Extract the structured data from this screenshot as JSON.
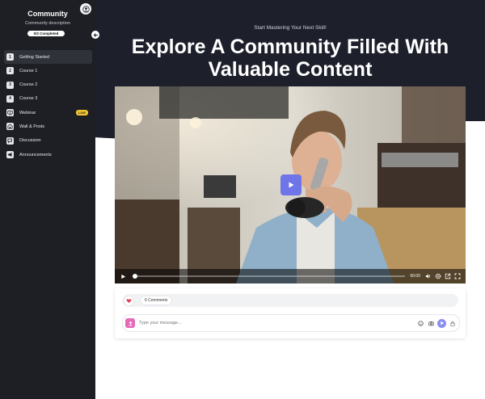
{
  "sidebar": {
    "title": "Community",
    "description": "Community description",
    "progress": "0/2 Completed",
    "items": [
      {
        "num": "1",
        "label": "Getting Started",
        "active": true
      },
      {
        "num": "2",
        "label": "Course 1"
      },
      {
        "num": "3",
        "label": "Course 2"
      },
      {
        "num": "4",
        "label": "Course 3"
      },
      {
        "icon": "webinar-icon",
        "label": "Webinar",
        "badge": "LIVE"
      },
      {
        "icon": "wall-icon",
        "label": "Wall & Posts"
      },
      {
        "icon": "discussion-icon",
        "label": "Discussion"
      },
      {
        "icon": "megaphone-icon",
        "label": "Announcements"
      }
    ]
  },
  "hero": {
    "kicker": "Start Mastering Your Next Skill!",
    "title_line1": "Explore A Community Filled With",
    "title_line2": "Valuable Content"
  },
  "video": {
    "time": "00:00",
    "progress": 0
  },
  "comments": {
    "count_label": "6 Comments",
    "placeholder": "Type your message..."
  },
  "colors": {
    "sidebar_bg": "#1d1f24",
    "hero_bg": "#1d1f2b",
    "accent": "#6f74e8",
    "live_badge": "#f4c430"
  }
}
